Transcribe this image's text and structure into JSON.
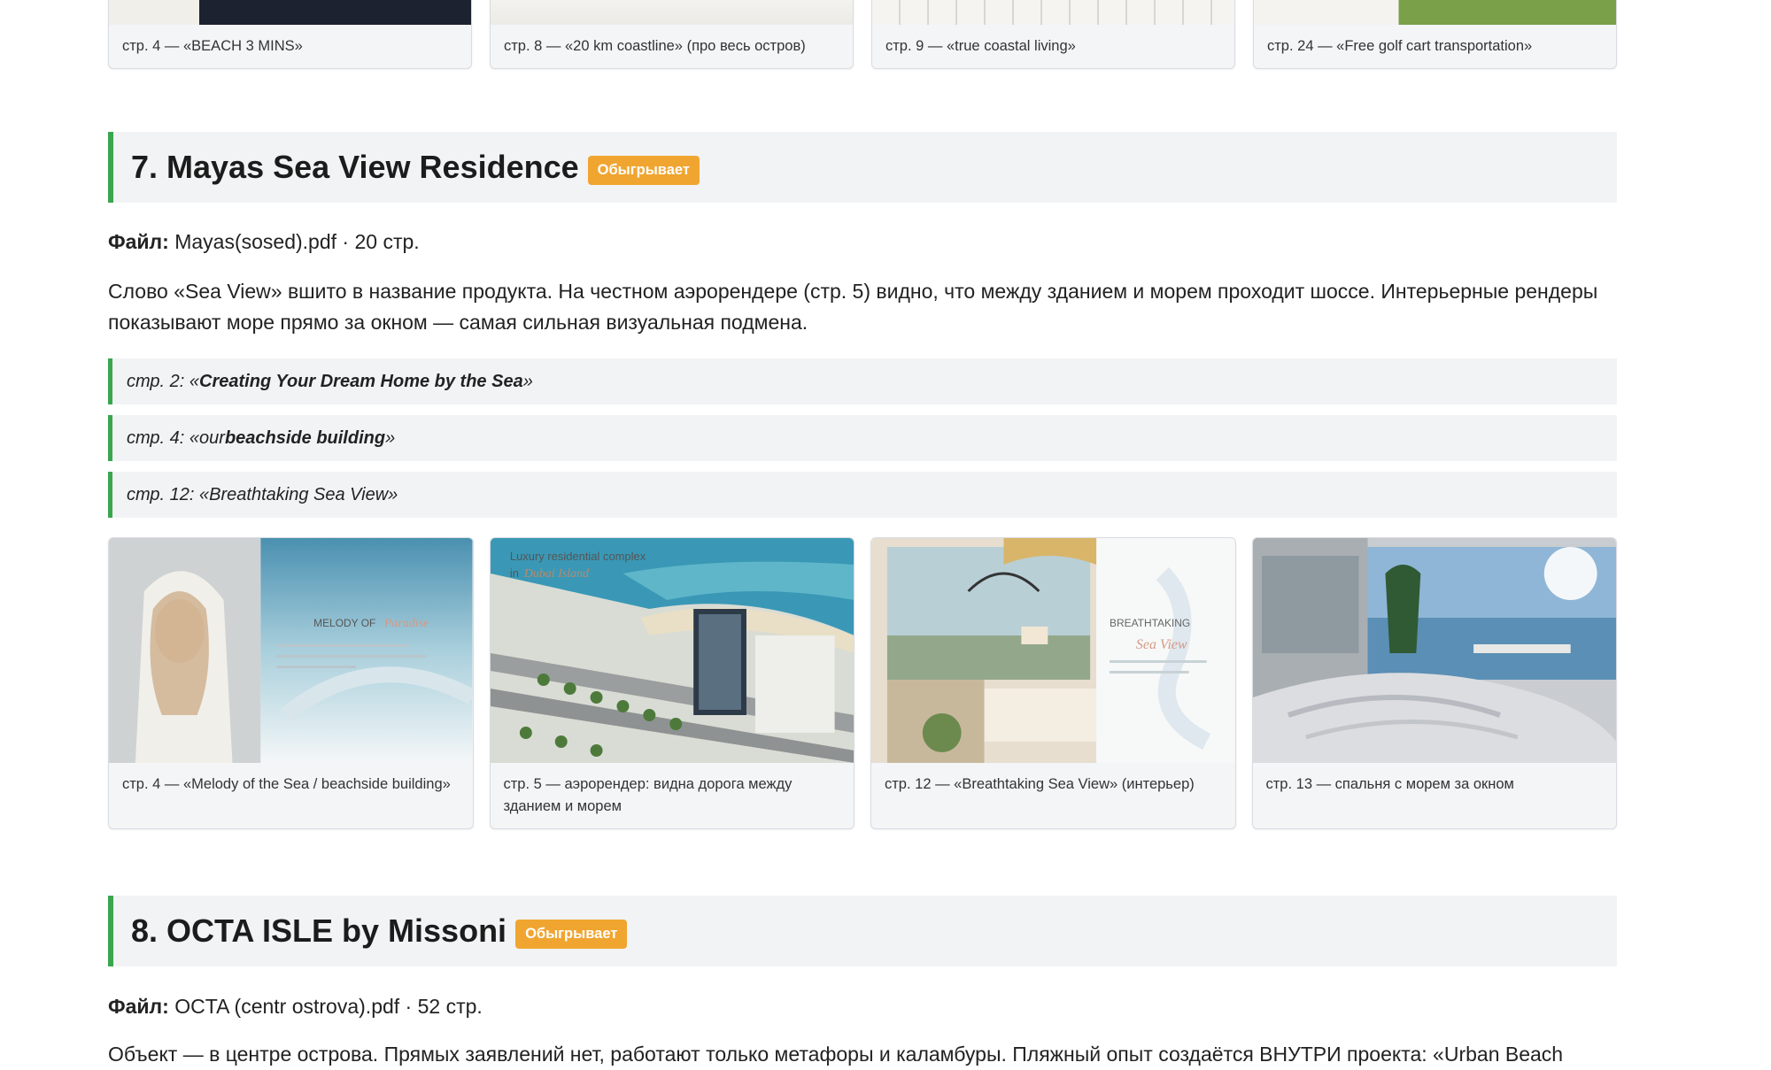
{
  "top_gallery": [
    {
      "caption": "стр. 4 — «BEACH 3 MINS»"
    },
    {
      "caption": "стр. 8 — «20 km coastline» (про весь остров)"
    },
    {
      "caption": "стр. 9 — «true coastal living»"
    },
    {
      "caption": "стр. 24 — «Free golf cart transportation»"
    }
  ],
  "section7": {
    "title": "7. Mayas Sea View Residence",
    "badge": "Обыгрывает",
    "file_label": "Файл:",
    "file_value": "Mayas(sosed).pdf · 20 стр.",
    "description": "Слово «Sea View» вшито в название продукта. На честном аэрорендере (стр. 5) видно, что между зданием и морем проходит шоссе. Интерьерные рендеры показывают море прямо за окном — самая сильная визуальная подмена.",
    "quotes": [
      {
        "prefix": "стр. 2: «",
        "bold": "Creating Your Dream Home by the Sea",
        "suffix": "»"
      },
      {
        "prefix": "стр. 4: «our ",
        "bold": "beachside building",
        "suffix": "»"
      },
      {
        "prefix": "стр. 12: «Breathtaking Sea View»",
        "bold": "",
        "suffix": ""
      }
    ],
    "gallery": [
      {
        "caption": "стр. 4 — «Melody of the Sea / beachside building»",
        "image_text": [
          "MELODY OF",
          "Paradise"
        ]
      },
      {
        "caption": "стр. 5 — аэрорендер: видна дорога между зданием и морем",
        "image_text": [
          "Luxury residential complex",
          "in",
          "Dubai Island"
        ]
      },
      {
        "caption": "стр. 12 — «Breathtaking Sea View» (интерьер)",
        "image_text": [
          "BREATHTAKING",
          "Sea View"
        ]
      },
      {
        "caption": "стр. 13 — спальня с морем за окном"
      }
    ]
  },
  "section8": {
    "title": "8. OCTA ISLE by Missoni",
    "badge": "Обыгрывает",
    "file_label": "Файл:",
    "file_value": "OCTA (centr ostrova).pdf · 52 стр.",
    "description": "Объект — в центре острова. Прямых заявлений нет, работают только метафоры и каламбуры. Пляжный опыт создаётся ВНУТРИ проекта: «Urban Beach"
  },
  "colors": {
    "accent_green": "#3aa64d",
    "badge_orange": "#f0a530",
    "panel_bg": "#f2f3f5"
  }
}
